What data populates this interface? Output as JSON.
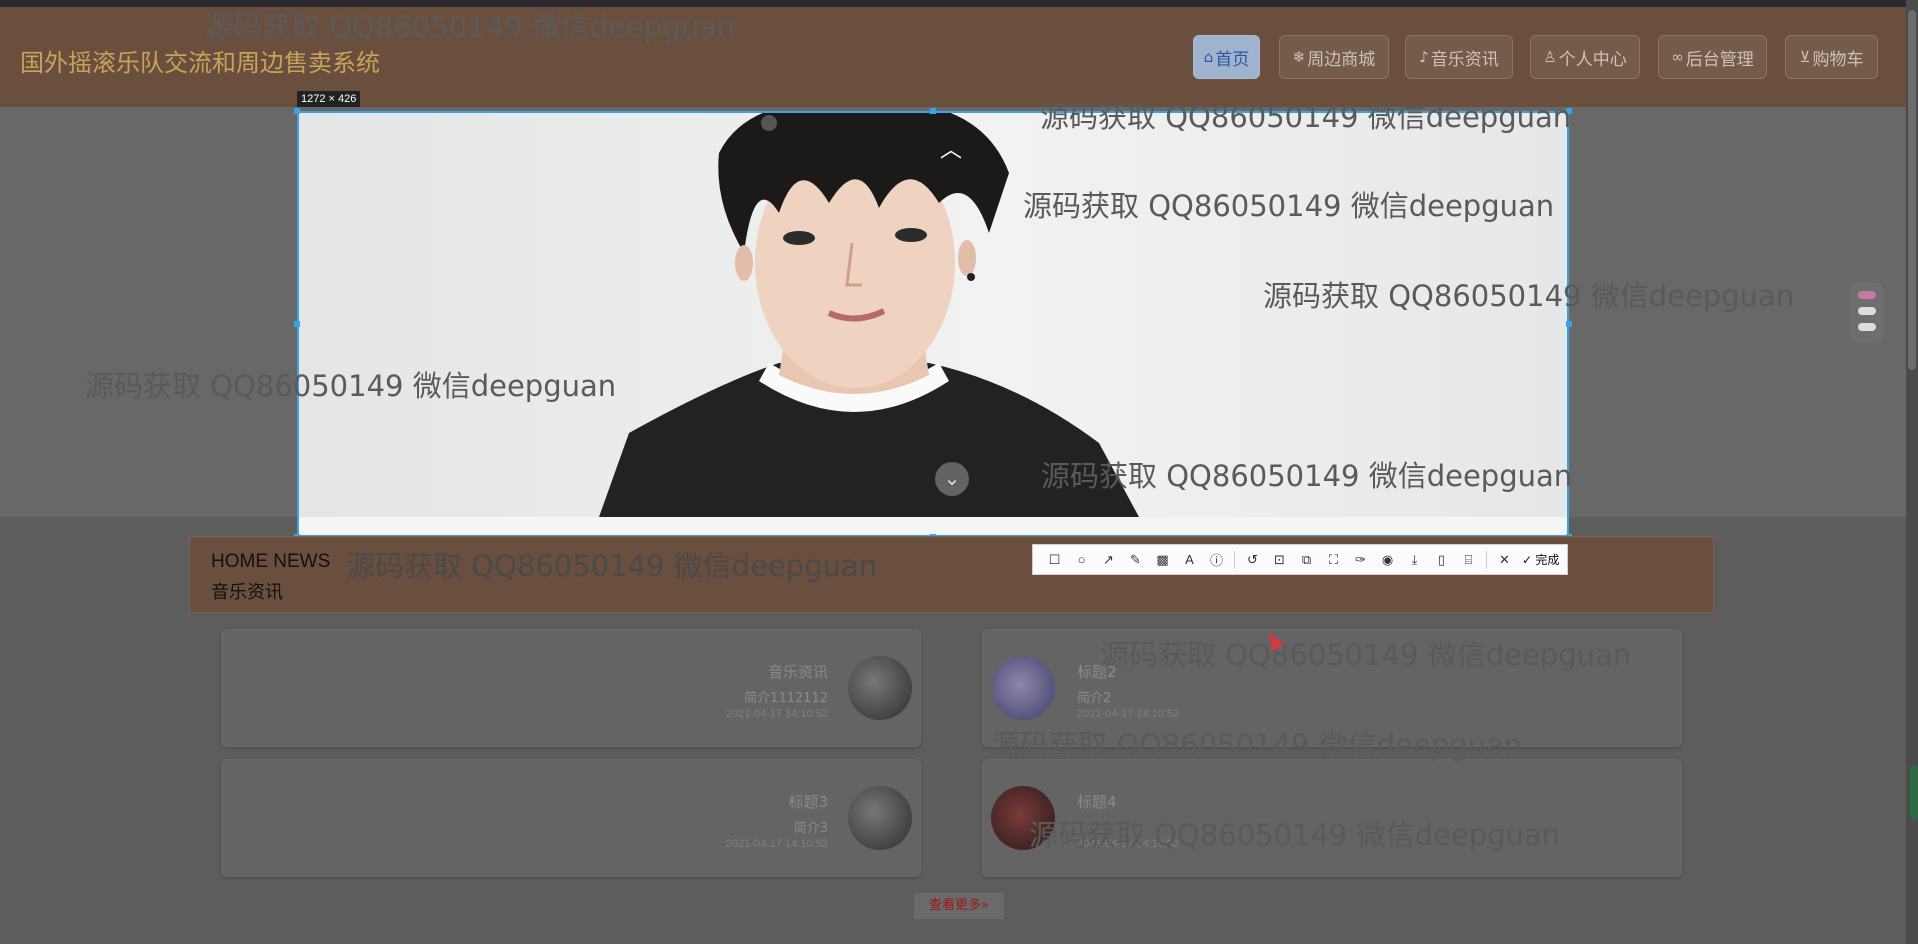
{
  "header": {
    "site_title": "国外摇滚乐队交流和周边售卖系统",
    "nav": [
      {
        "label": "首页",
        "icon": "home-icon"
      },
      {
        "label": "周边商城",
        "icon": "snowflake-icon"
      },
      {
        "label": "音乐资讯",
        "icon": "music-icon"
      },
      {
        "label": "个人中心",
        "icon": "user-icon"
      },
      {
        "label": "后台管理",
        "icon": "link-icon"
      },
      {
        "label": "购物车",
        "icon": "cart-icon"
      }
    ]
  },
  "selection": {
    "size_label": "1272 × 426"
  },
  "toolbar": {
    "tools": [
      "rectangle-icon",
      "circle-icon",
      "arrow-icon",
      "pencil-icon",
      "mosaic-icon",
      "text-icon",
      "number-icon",
      "undo-icon",
      "ocr-icon",
      "translate-icon",
      "scan-icon",
      "pin-icon",
      "record-icon",
      "download-icon",
      "copy-icon",
      "save-icon"
    ],
    "cancel_icon": "close-icon",
    "done_label": "完成"
  },
  "news_section": {
    "title": "HOME NEWS",
    "subtitle": "音乐资讯"
  },
  "news": [
    {
      "title": "音乐资讯",
      "desc": "简介1112112",
      "time": "2021-04-17 14:10:52"
    },
    {
      "title": "标题2",
      "desc": "简介2",
      "time": "2021-04-17 14:10:52"
    },
    {
      "title": "标题3",
      "desc": "简介3",
      "time": "2021-04-17 14:10:52"
    },
    {
      "title": "标题4",
      "desc": "",
      "time": "2021-04-17 14:10:52"
    }
  ],
  "more_link": "查看更多»",
  "watermark": "源码获取 QQ86050149 微信deepguan"
}
